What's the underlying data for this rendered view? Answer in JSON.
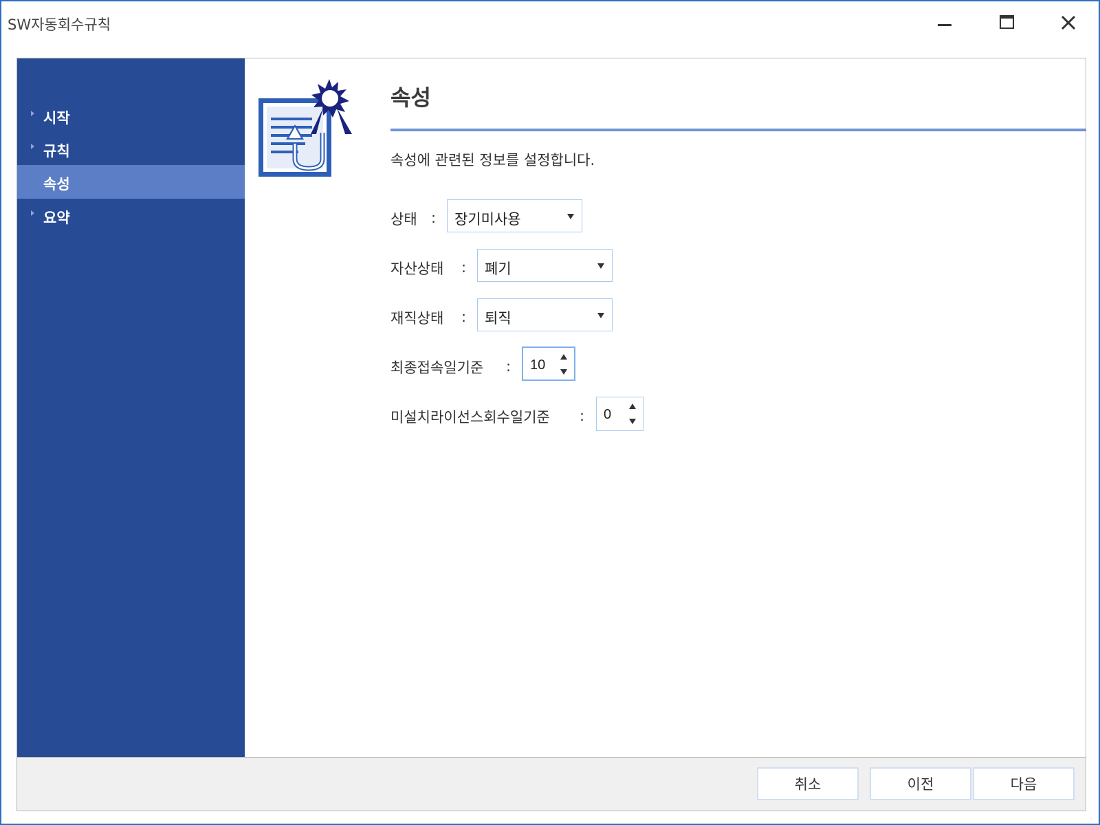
{
  "window": {
    "title": "SW자동회수규칙"
  },
  "sidebar": {
    "items": [
      {
        "label": "시작",
        "active": false
      },
      {
        "label": "규칙",
        "active": false
      },
      {
        "label": "속성",
        "active": true
      },
      {
        "label": "요약",
        "active": false
      }
    ]
  },
  "page": {
    "title": "속성",
    "description": "속성에 관련된 정보를 설정합니다.",
    "icon": "document-update-icon"
  },
  "form": {
    "colon": ":",
    "status": {
      "label": "상태",
      "value": "장기미사용"
    },
    "asset_status": {
      "label": "자산상태",
      "value": "폐기"
    },
    "employment_status": {
      "label": "재직상태",
      "value": "퇴직"
    },
    "last_access_days": {
      "label": "최종접속일기준",
      "value": "10"
    },
    "uninstalled_license_days": {
      "label": "미설치라이선스회수일기준",
      "value": "0"
    }
  },
  "footer": {
    "cancel_label": "취소",
    "prev_label": "이전",
    "next_label": "다음"
  },
  "colors": {
    "sidebar_bg": "#284b95",
    "sidebar_active": "#5b7ec6",
    "accent_rule": "#6f94d6",
    "window_border": "#2b6fc4",
    "footer_bg": "#f0f0f0"
  }
}
